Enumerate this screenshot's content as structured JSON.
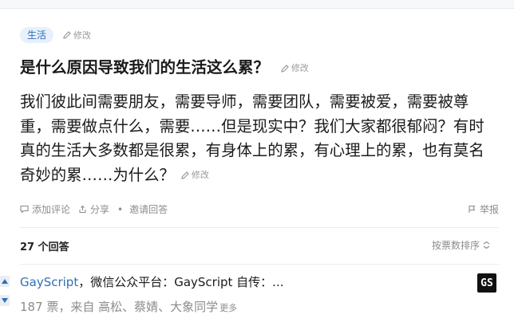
{
  "question": {
    "topic_tag": "生活",
    "edit_label": "修改",
    "title": "是什么原因导致我们的生活这么累？",
    "body_lines": [
      "我们彼此间需要朋友，需要导师，需要团队，需要被爱，需要被尊",
      "重，需要做点什么，需要……但是现实中？我们大家都很郁闷？有时",
      "真的生活大多数都是很累，有身体上的累，有心理上的累，也有莫名",
      "奇妙的累……为什么？"
    ],
    "actions": {
      "comment": "添加评论",
      "share": "分享",
      "separator": "•",
      "invite": "邀请回答",
      "report": "举报"
    }
  },
  "answers": {
    "count_label": "27 个回答",
    "sort_label": "按票数排序",
    "first": {
      "author": "GayScript",
      "bio": "，微信公众平台：GayScript 自传：...",
      "badge": "GS",
      "votes_line": "187 票，来自 高松、蔡婧、大象同学",
      "more": "更多"
    }
  },
  "icons": {
    "edit": "pencil-icon",
    "comment": "comment-icon",
    "share": "share-icon",
    "report": "flag-icon",
    "sort": "sort-arrow-icon",
    "vote_up": "triangle-up-icon",
    "vote_down": "triangle-down-icon"
  },
  "colors": {
    "link": "#2f6fba",
    "tag_bg": "#e8f0fb",
    "muted": "#8c8c8c"
  }
}
